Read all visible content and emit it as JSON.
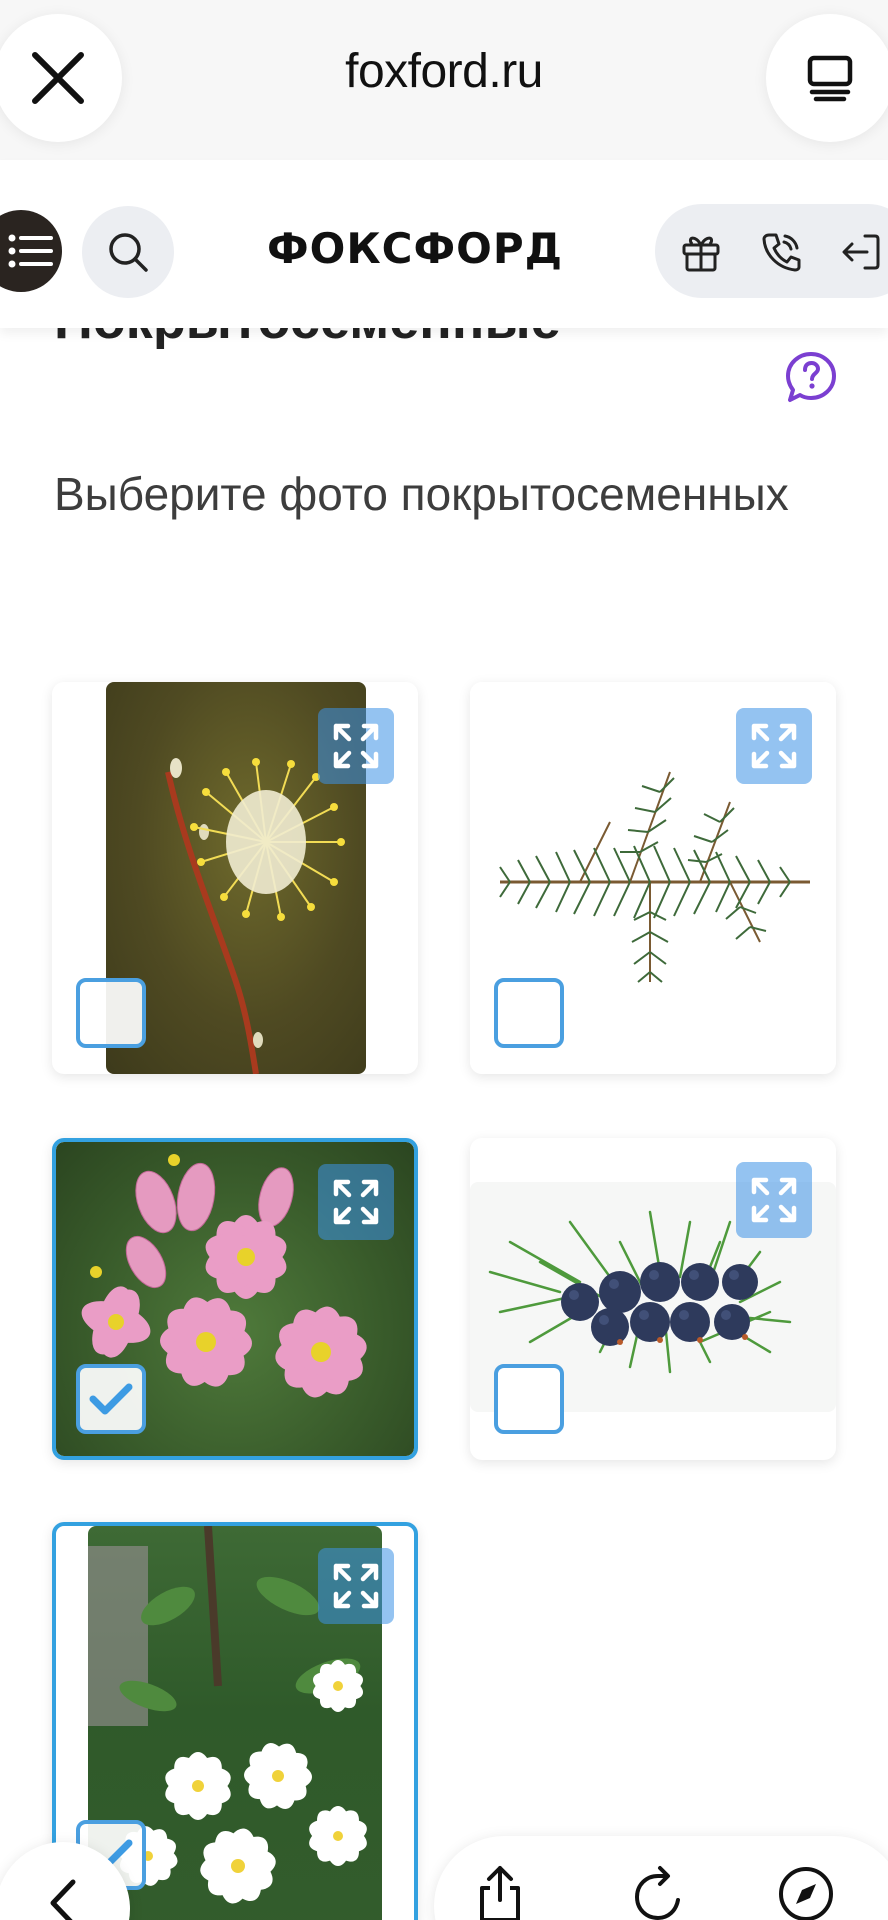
{
  "browser": {
    "url": "foxford.ru",
    "close_icon": "close-icon",
    "tabs_icon": "tabs-icon"
  },
  "header": {
    "logo": "ФОКСФОРД",
    "menu_icon": "menu-list-icon",
    "search_icon": "search-icon",
    "actions": [
      "gift-icon",
      "phone-icon",
      "login-icon"
    ]
  },
  "content": {
    "title_partial": "Покрытосеменные",
    "task": "Выберите фото покрытосеменных",
    "help_icon": "help-question-icon"
  },
  "options": [
    {
      "subject": "willow-catkin-photo",
      "selected": false
    },
    {
      "subject": "spruce-branch-photo",
      "selected": false
    },
    {
      "subject": "pink-flowers-photo",
      "selected": true
    },
    {
      "subject": "juniper-berries-photo",
      "selected": false
    },
    {
      "subject": "white-flowers-photo",
      "selected": true
    }
  ],
  "colors": {
    "accent": "#33a1e0",
    "checkbox_border": "#4a9fe0",
    "help_purple": "#7b3fd1"
  },
  "toolbar": {
    "icons": [
      "back-icon",
      "share-icon",
      "reload-icon",
      "compass-icon"
    ]
  }
}
